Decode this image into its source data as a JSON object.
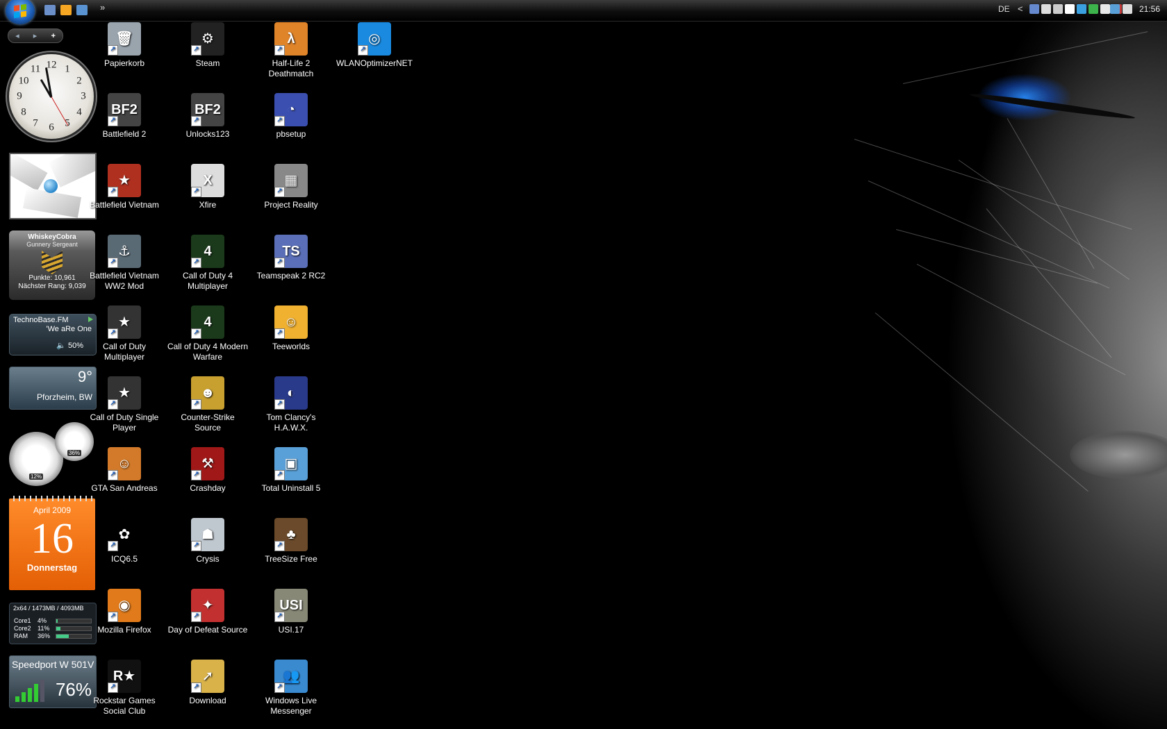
{
  "taskbar": {
    "language": "DE",
    "tray_expand": "<",
    "clock": "21:56",
    "more": "»",
    "quicklaunch_colors": [
      "#6a8fc9",
      "#f5a623",
      "#5a93d1"
    ],
    "tray_colors": [
      "#6688cc",
      "#dddddd",
      "#cccccc",
      "#ffffff",
      "#3aa0e0",
      "#3cb44b",
      "#e8e8e8",
      "#c33b3b",
      "#5aa0d8",
      "#dddddd"
    ]
  },
  "sidebar": {
    "nav_prev": "◂",
    "nav_next": "▸",
    "nav_add": "+",
    "rank": {
      "name": "WhiskeyCobra",
      "title": "Gunnery Sergeant",
      "points": "Punkte: 10,961",
      "next": "Nächster Rang: 9,039"
    },
    "radio": {
      "station": "TechnoBase.FM",
      "track": "'We aRe One",
      "volume": "50%"
    },
    "weather": {
      "temp": "9°",
      "city": "Pforzheim, BW"
    },
    "meters": {
      "cpu": "12%",
      "ram": "36%",
      "cpu_fraction": 0.12,
      "ram_fraction": 0.36
    },
    "calendar": {
      "month": "April 2009",
      "day": "16",
      "weekday": "Donnerstag"
    },
    "cpu": {
      "header": "2x64 / 1473MB / 4093MB",
      "rows": [
        {
          "label": "Core1",
          "value": "4%",
          "fraction": 0.04
        },
        {
          "label": "Core2",
          "value": "11%",
          "fraction": 0.11
        },
        {
          "label": "RAM",
          "value": "36%",
          "fraction": 0.36
        }
      ]
    },
    "wifi": {
      "name": "Speedport W 501V",
      "signal": "76%",
      "fraction": 0.76
    }
  },
  "icons": [
    {
      "label": "Papierkorb",
      "color": "#9aa4ad",
      "glyph": "🗑"
    },
    {
      "label": "Battlefield 2",
      "color": "#444444",
      "glyph": "BF2"
    },
    {
      "label": "Battlefield Vietnam",
      "color": "#b03020",
      "glyph": "★"
    },
    {
      "label": "Battlefield Vietnam WW2 Mod",
      "color": "#5a6a75",
      "glyph": "⚓"
    },
    {
      "label": "Call of Duty Multiplayer",
      "color": "#333333",
      "glyph": "★"
    },
    {
      "label": "Call of Duty Single Player",
      "color": "#333333",
      "glyph": "★"
    },
    {
      "label": "GTA San Andreas",
      "color": "#d27a2a",
      "glyph": "☺"
    },
    {
      "label": "ICQ6.5",
      "color": "#000000",
      "glyph": "✿"
    },
    {
      "label": "Mozilla Firefox",
      "color": "#e07a1a",
      "glyph": "◉"
    },
    {
      "label": "Rockstar Games Social Club",
      "color": "#111111",
      "glyph": "R★"
    },
    {
      "label": "Steam",
      "color": "#222222",
      "glyph": "⚙"
    },
    {
      "label": "Unlocks123",
      "color": "#444444",
      "glyph": "BF2"
    },
    {
      "label": "Xfire",
      "color": "#dddddd",
      "glyph": "X"
    },
    {
      "label": "Call of Duty 4 Multiplayer",
      "color": "#1b3a1b",
      "glyph": "4"
    },
    {
      "label": "Call of Duty 4 Modern Warfare",
      "color": "#1b3a1b",
      "glyph": "4"
    },
    {
      "label": "Counter-Strike Source",
      "color": "#c8a030",
      "glyph": "☻"
    },
    {
      "label": "Crashday",
      "color": "#a01818",
      "glyph": "⚒"
    },
    {
      "label": "Crysis",
      "color": "#bfc7cf",
      "glyph": "☗"
    },
    {
      "label": "Day of Defeat Source",
      "color": "#c23030",
      "glyph": "✦"
    },
    {
      "label": "Download",
      "color": "#d9b24a",
      "glyph": "➚"
    },
    {
      "label": "Half-Life 2 Deathmatch",
      "color": "#e0842a",
      "glyph": "λ"
    },
    {
      "label": "pbsetup",
      "color": "#3b4fb0",
      "glyph": "◔"
    },
    {
      "label": "Project Reality",
      "color": "#888888",
      "glyph": "▦"
    },
    {
      "label": "Teamspeak 2 RC2",
      "color": "#5a6fb8",
      "glyph": "TS"
    },
    {
      "label": "Teeworlds",
      "color": "#f0b030",
      "glyph": "☺"
    },
    {
      "label": "Tom Clancy's H.A.W.X.",
      "color": "#2a3a8a",
      "glyph": "◐"
    },
    {
      "label": "Total Uninstall 5",
      "color": "#5aa0d8",
      "glyph": "▣"
    },
    {
      "label": "TreeSize Free",
      "color": "#6a4a2a",
      "glyph": "♣"
    },
    {
      "label": "USI.17",
      "color": "#888877",
      "glyph": "USI"
    },
    {
      "label": "Windows Live Messenger",
      "color": "#3a8ad0",
      "glyph": "👥"
    },
    {
      "label": "WLANOptimizerNET",
      "color": "#1a8ae0",
      "glyph": "◎"
    }
  ]
}
